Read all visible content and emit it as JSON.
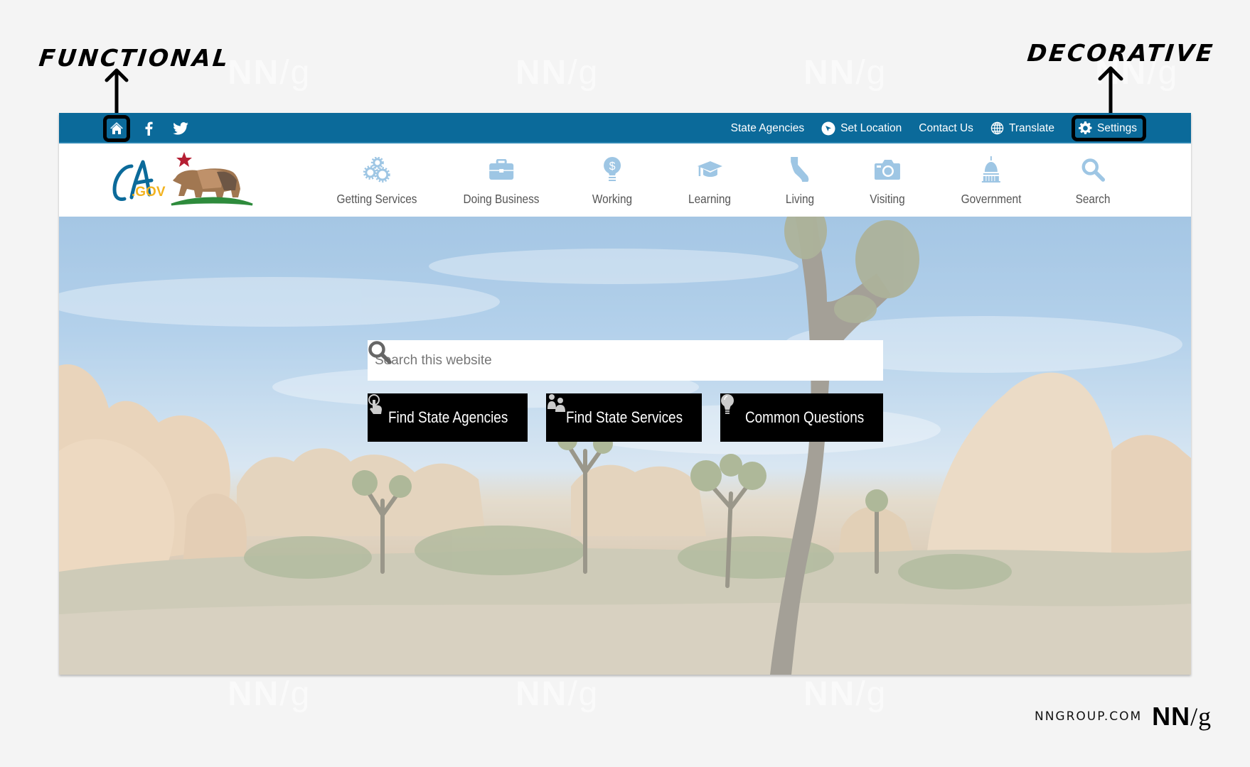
{
  "annotations": {
    "functional": "FUNCTIONAL",
    "decorative": "DECORATIVE"
  },
  "watermark": {
    "text_bold": "NN",
    "text_slash": "/g"
  },
  "utility_bar": {
    "left_icons": [
      {
        "name": "home-icon",
        "label": "Home"
      },
      {
        "name": "facebook-icon",
        "label": "Facebook"
      },
      {
        "name": "twitter-icon",
        "label": "Twitter"
      }
    ],
    "links": [
      {
        "label": "State Agencies",
        "icon": ""
      },
      {
        "label": "Set Location",
        "icon": "location-icon"
      },
      {
        "label": "Contact Us",
        "icon": ""
      },
      {
        "label": "Translate",
        "icon": "globe-icon"
      },
      {
        "label": "Settings",
        "icon": "gear-icon"
      }
    ]
  },
  "logo": {
    "text_ca": "CA",
    "text_gov": ".GOV"
  },
  "nav": {
    "items": [
      {
        "label": "Getting Services",
        "icon": "gears-icon"
      },
      {
        "label": "Doing Business",
        "icon": "briefcase-icon"
      },
      {
        "label": "Working",
        "icon": "dollar-bulb-icon"
      },
      {
        "label": "Learning",
        "icon": "graduation-cap-icon"
      },
      {
        "label": "Living",
        "icon": "california-icon"
      },
      {
        "label": "Visiting",
        "icon": "camera-icon"
      },
      {
        "label": "Government",
        "icon": "capitol-icon"
      },
      {
        "label": "Search",
        "icon": "search-icon"
      }
    ]
  },
  "hero": {
    "search": {
      "placeholder": "Search this website",
      "value": ""
    },
    "buttons": [
      {
        "label": "Find State Agencies",
        "icon": "pointer-hand-icon"
      },
      {
        "label": "Find State Services",
        "icon": "people-icon"
      },
      {
        "label": "Common Questions",
        "icon": "lightbulb-icon"
      }
    ]
  },
  "footer_brand": {
    "url": "NNGROUP.COM",
    "logo_bold": "NN",
    "logo_slash": "/g"
  },
  "colors": {
    "utility_bar": "#0b6a9a",
    "nav_icon": "#9ec6e4",
    "nav_text": "#555555",
    "cta_bg": "#000000",
    "page_bg": "#f4f4f4"
  }
}
